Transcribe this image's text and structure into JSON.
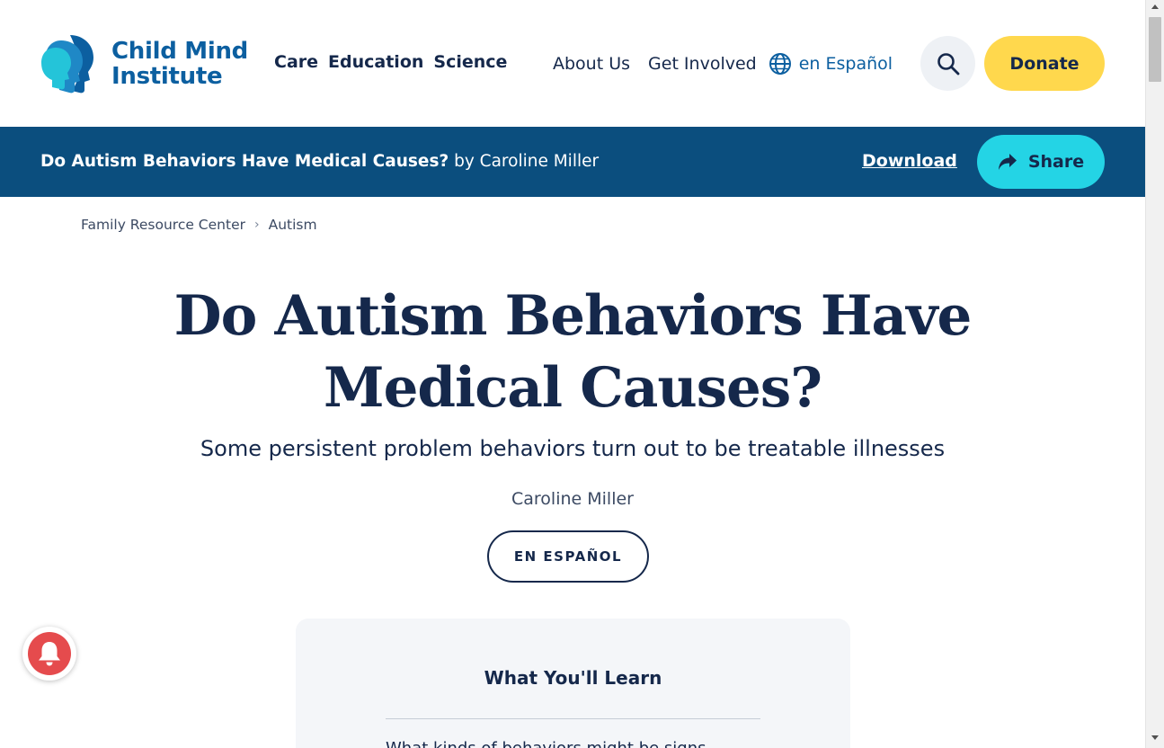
{
  "header": {
    "logo_line1": "Child Mind",
    "logo_line2": "Institute",
    "nav_main": [
      "Care",
      "Education",
      "Science"
    ],
    "nav_secondary": [
      "About Us",
      "Get Involved"
    ],
    "language_link": "en Español",
    "donate_label": "Donate"
  },
  "article_bar": {
    "title": "Do Autism Behaviors Have Medical Causes?",
    "byline": "by Caroline Miller",
    "download_label": "Download",
    "share_label": "Share"
  },
  "breadcrumb": {
    "items": [
      "Family Resource Center",
      "Autism"
    ]
  },
  "article": {
    "title": "Do Autism Behaviors Have Medical Causes?",
    "subtitle": "Some persistent problem behaviors turn out to be treatable illnesses",
    "author": "Caroline Miller",
    "language_button": "EN ESPAÑOL"
  },
  "learn_box": {
    "title": "What You'll Learn",
    "first_item_partial": "What kinds of behaviors might be signs"
  },
  "colors": {
    "brand_blue": "#0b4e7e",
    "navy": "#15284b",
    "donate_yellow": "#ffd84d",
    "share_cyan": "#24d4e5",
    "bell_red": "#e54b4d"
  },
  "icons": {
    "search": "search-icon",
    "globe": "globe-icon",
    "share": "share-icon",
    "bell": "bell-icon",
    "chevron": "chevron-right-icon"
  }
}
